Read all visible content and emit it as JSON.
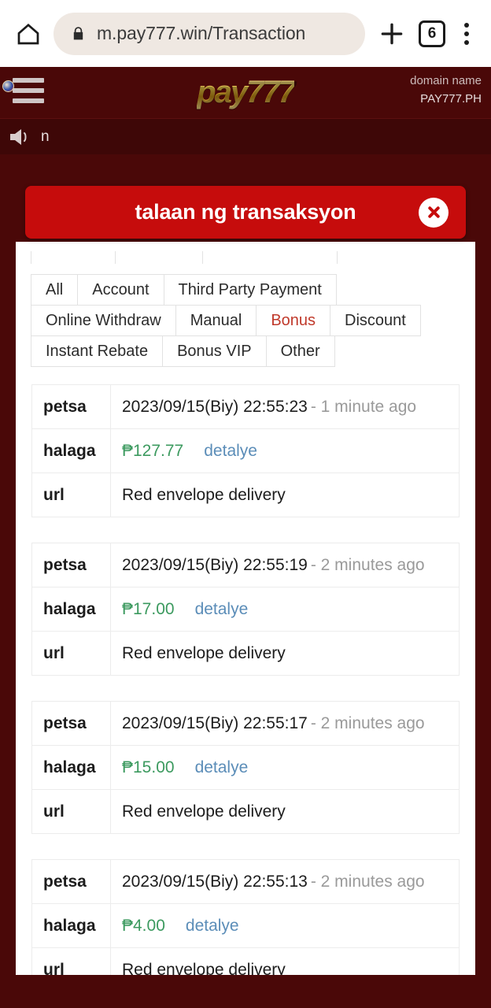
{
  "browser": {
    "home_icon": "home-icon",
    "lock_icon": "lock-icon",
    "url": "m.pay777.win/Transaction",
    "new_tab_icon": "plus-icon",
    "tab_count": "6",
    "menu_icon": "kebab-menu-icon"
  },
  "site_header": {
    "menu_icon": "hamburger-icon",
    "logo_text": "pay777",
    "logo_flag_icon": "philippines-flag-icon",
    "domain_label": "domain name",
    "domain_value": "PAY777.PH"
  },
  "marquee": {
    "speaker_icon": "speaker-icon",
    "text": "n"
  },
  "toast": {
    "title": "talaan ng transaksyon",
    "close_icon": "close-circle-icon",
    "background_color": "#c60c0c"
  },
  "filters": {
    "clipped_row": [
      "",
      "",
      "",
      ""
    ],
    "tabs": [
      {
        "label": "All",
        "active": false
      },
      {
        "label": "Account",
        "active": false
      },
      {
        "label": "Third Party Payment",
        "active": false
      },
      {
        "label": "Online Withdraw",
        "active": false
      },
      {
        "label": "Manual",
        "active": false
      },
      {
        "label": "Bonus",
        "active": true
      },
      {
        "label": "Discount",
        "active": false
      },
      {
        "label": "Instant Rebate",
        "active": false
      },
      {
        "label": "Bonus VIP",
        "active": false
      },
      {
        "label": "Other",
        "active": false
      }
    ],
    "active_color": "#c0392b"
  },
  "labels": {
    "date": "petsa",
    "amount": "halaga",
    "url": "url",
    "detail": "detalye"
  },
  "transactions": [
    {
      "date": "2023/09/15(Biy) 22:55:23",
      "relative": "- 1 minute ago",
      "amount": "₱127.77",
      "detail": "detalye",
      "url": "Red envelope delivery"
    },
    {
      "date": "2023/09/15(Biy) 22:55:19",
      "relative": "- 2 minutes ago",
      "amount": "₱17.00",
      "detail": "detalye",
      "url": "Red envelope delivery"
    },
    {
      "date": "2023/09/15(Biy) 22:55:17",
      "relative": "- 2 minutes ago",
      "amount": "₱15.00",
      "detail": "detalye",
      "url": "Red envelope delivery"
    },
    {
      "date": "2023/09/15(Biy) 22:55:13",
      "relative": "- 2 minutes ago",
      "amount": "₱4.00",
      "detail": "detalye",
      "url": "Red envelope delivery"
    }
  ],
  "colors": {
    "page_background": "#4a0808",
    "amount_green": "#3c9a5f",
    "link_blue": "#5b8db8",
    "logo_gold": "#e8c445"
  }
}
